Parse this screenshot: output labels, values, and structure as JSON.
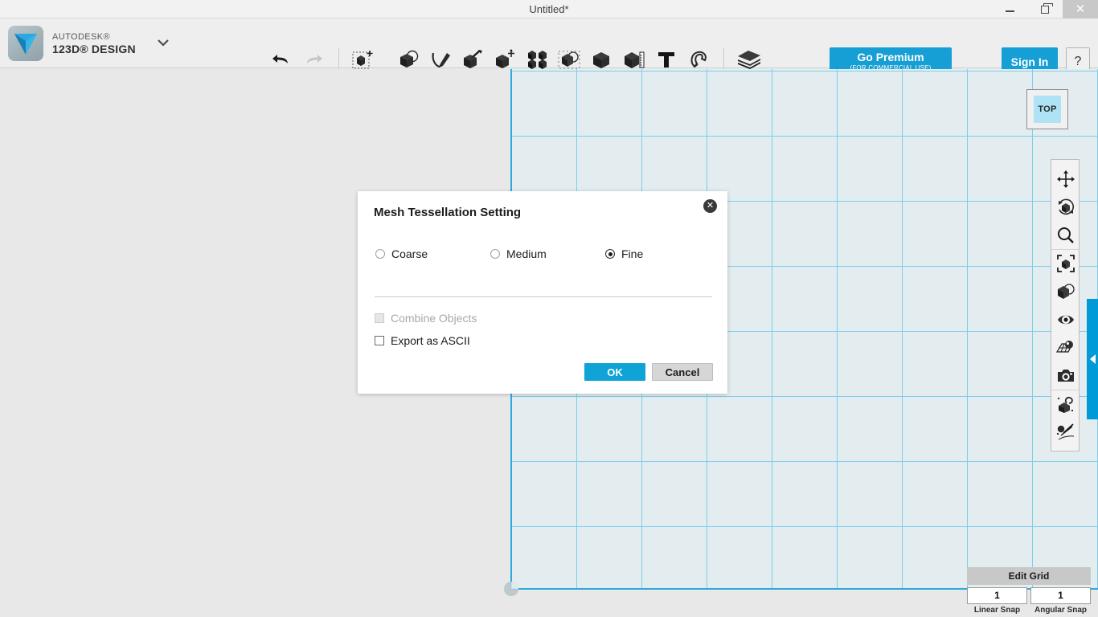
{
  "window": {
    "title": "Untitled*",
    "minimize_label": "Minimize",
    "maximize_label": "Maximize",
    "close_label": "Close"
  },
  "brand": {
    "line1": "AUTODESK®",
    "line2": "123D® DESIGN",
    "menu_caret": "chevron-down"
  },
  "toolbar": {
    "items": [
      {
        "name": "new-primitive",
        "label": "Primitives",
        "has_dropdown": false,
        "selected": true
      },
      {
        "name": "combine",
        "label": "Combine",
        "has_dropdown": true
      },
      {
        "name": "sketch",
        "label": "Sketch",
        "has_dropdown": true
      },
      {
        "name": "construct",
        "label": "Construct",
        "has_dropdown": true
      },
      {
        "name": "modify",
        "label": "Modify",
        "has_dropdown": true
      },
      {
        "name": "pattern",
        "label": "Pattern",
        "has_dropdown": true
      },
      {
        "name": "grouping",
        "label": "Grouping",
        "has_dropdown": true
      },
      {
        "name": "snap",
        "label": "Snap",
        "has_dropdown": true
      },
      {
        "name": "measure",
        "label": "Measure",
        "has_dropdown": true
      },
      {
        "name": "text",
        "label": "Text",
        "has_dropdown": false
      },
      {
        "name": "magnet",
        "label": "Magnet",
        "has_dropdown": false
      },
      {
        "name": "material",
        "label": "Material",
        "has_dropdown": false
      }
    ],
    "undo_label": "Undo",
    "redo_label": "Redo",
    "undo_enabled": true,
    "redo_enabled": false
  },
  "header_actions": {
    "premium_main": "Go Premium",
    "premium_sub": "(FOR COMMERCIAL USE)",
    "sign_in": "Sign In",
    "help": "?",
    "accent_color": "#159fd4"
  },
  "canvas": {
    "view_cube_label": "TOP",
    "grid_fill": "#e3edf0",
    "grid_line_color": "#7ccdec",
    "grid_axis_color": "#2fa8dd",
    "background": "#e8e8e8",
    "panel_tab_color": "#009ad8",
    "panel_tab_icon": "chevron-left-icon"
  },
  "nav_tools": [
    {
      "name": "pan-icon",
      "label": "Pan"
    },
    {
      "name": "orbit-icon",
      "label": "Orbit"
    },
    {
      "name": "zoom-icon",
      "label": "Zoom"
    },
    {
      "name": "fit-icon",
      "label": "Fit"
    },
    {
      "name": "view-cube-icon",
      "label": "Home View"
    },
    {
      "name": "visibility-icon",
      "label": "Show / Hide"
    },
    {
      "name": "grid-snap-icon",
      "label": "Grid Snap"
    },
    {
      "name": "camera-icon",
      "label": "Camera"
    },
    {
      "name": "materials-icon",
      "label": "Materials"
    },
    {
      "name": "effects-icon",
      "label": "Effects"
    }
  ],
  "grid_controls": {
    "edit_grid_label": "Edit Grid",
    "linear_snap_value": "1",
    "angular_snap_value": "1",
    "linear_snap_label": "Linear Snap",
    "angular_snap_label": "Angular Snap"
  },
  "dialog": {
    "title": "Mesh Tessellation Setting",
    "close_glyph": "✕",
    "tessellation_options": [
      {
        "label": "Coarse",
        "selected": false
      },
      {
        "label": "Medium",
        "selected": false
      },
      {
        "label": "Fine",
        "selected": true
      }
    ],
    "checkboxes": [
      {
        "label": "Combine Objects",
        "checked": false,
        "enabled": false
      },
      {
        "label": "Export as ASCII",
        "checked": false,
        "enabled": true
      }
    ],
    "ok_label": "OK",
    "cancel_label": "Cancel",
    "ok_color": "#0fa3d6"
  }
}
